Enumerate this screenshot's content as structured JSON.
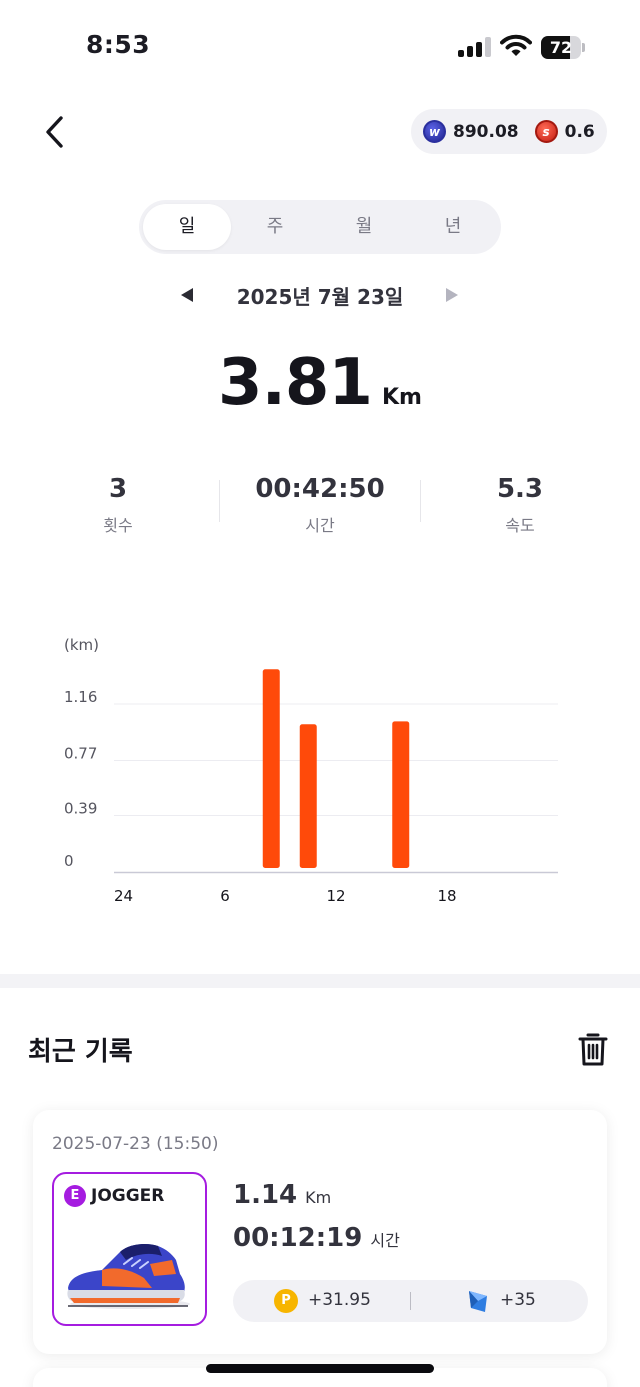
{
  "status_bar": {
    "time": "8:53",
    "battery": "72",
    "battery_level_percent": 72
  },
  "header": {
    "balances": [
      {
        "icon": "w-coin-icon",
        "value": "890.08"
      },
      {
        "icon": "s-coin-icon",
        "value": "0.6"
      }
    ]
  },
  "period_tabs": [
    {
      "label": "일",
      "active": true
    },
    {
      "label": "주",
      "active": false
    },
    {
      "label": "월",
      "active": false
    },
    {
      "label": "년",
      "active": false
    }
  ],
  "date": {
    "label": "2025년 7월 23일"
  },
  "summary": {
    "distance": "3.81",
    "distance_unit": "Km",
    "stats": [
      {
        "value": "3",
        "label": "횟수"
      },
      {
        "value": "00:42:50",
        "label": "시간"
      },
      {
        "value": "5.3",
        "label": "속도"
      }
    ]
  },
  "chart_data": {
    "type": "bar",
    "ylabel": "(km)",
    "y_ticks": [
      "1.16",
      "0.77",
      "0.39",
      "0"
    ],
    "y_tick_values": [
      1.16,
      0.77,
      0.39,
      0
    ],
    "ylim": [
      0,
      1.16
    ],
    "x_ticks": [
      "24",
      "6",
      "12",
      "18"
    ],
    "x_tick_hours": [
      0,
      6,
      12,
      18
    ],
    "xlim": [
      0,
      24
    ],
    "bar_color": "#FF4A0A",
    "bars": [
      {
        "hour": 8,
        "value": 1.4
      },
      {
        "hour": 10,
        "value": 1.02
      },
      {
        "hour": 15,
        "value": 1.04
      }
    ]
  },
  "recent": {
    "title": "최근 기록",
    "records": [
      {
        "datetime": "2025-07-23 (15:50)",
        "grade": "E",
        "grade_label": "JOGGER",
        "distance": "1.14",
        "distance_unit": "Km",
        "time": "00:12:19",
        "time_unit": "시간",
        "reward_points": "+31.95",
        "reward_tiles": "+35"
      }
    ]
  },
  "colors": {
    "accent": "#FF4A0A",
    "grade_purple": "#A51CE0",
    "point_gold": "#F7B500",
    "tile_blue": "#2F7DE1"
  }
}
